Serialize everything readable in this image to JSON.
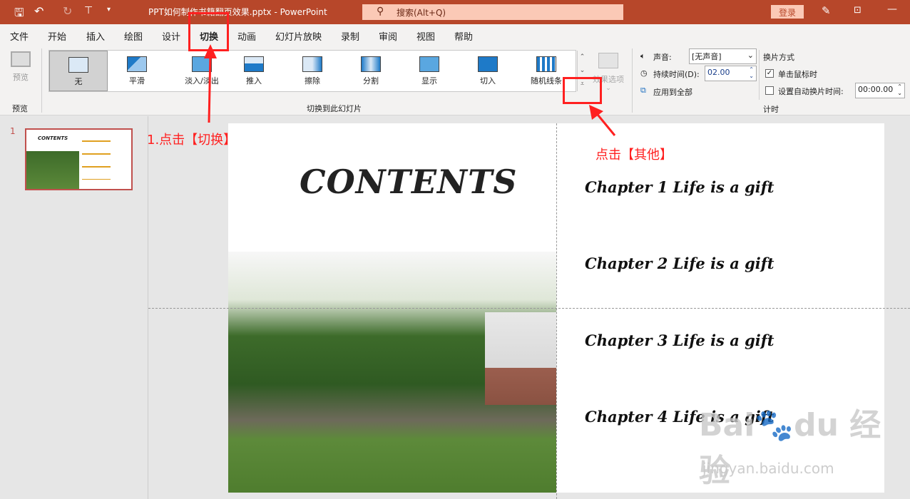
{
  "titlebar": {
    "title": "PPT如何制作书籍翻页效果.pptx  -  PowerPoint",
    "search_placeholder": "搜索(Alt+Q)",
    "login": "登录",
    "icons": [
      "save-icon",
      "undo-icon",
      "redo-icon",
      "present-icon",
      "customize-icon",
      "pen-icon",
      "ribbon-display-icon",
      "minimize-icon"
    ]
  },
  "menu": {
    "tabs": [
      "文件",
      "开始",
      "插入",
      "绘图",
      "设计",
      "切换",
      "动画",
      "幻灯片放映",
      "录制",
      "审阅",
      "视图",
      "帮助"
    ],
    "active": "切换"
  },
  "ribbon": {
    "preview": {
      "button": "预览",
      "group": "预览"
    },
    "transitions": [
      "无",
      "平滑",
      "淡入/淡出",
      "推入",
      "擦除",
      "分割",
      "显示",
      "切入",
      "随机线条"
    ],
    "selected": "无",
    "effect_options": "效果选项",
    "group_label": "切换到此幻灯片",
    "timing": {
      "sound_label": "声音:",
      "sound_value": "[无声音]",
      "duration_label": "持续时间(D):",
      "duration_value": "02.00",
      "apply_all": "应用到全部",
      "advance_label": "换片方式",
      "on_click": "单击鼠标时",
      "on_click_checked": true,
      "auto_label": "设置自动换片时间:",
      "auto_checked": false,
      "auto_value": "00:00.00",
      "group_label": "计时"
    }
  },
  "slides": {
    "number": "1"
  },
  "slide": {
    "title": "CONTENTS",
    "chapters": [
      "Chapter 1 Life is a gift",
      "Chapter 2 Life is a gift",
      "Chapter 3 Life is a gift",
      "Chapter 4 Life is a gift"
    ]
  },
  "annotations": {
    "step1": "1.点击【切换】",
    "step2": "点击【其他】",
    "color": "#ff2020"
  },
  "watermark": {
    "logo": "Baidu经验",
    "url": "jingyan.baidu.com"
  }
}
